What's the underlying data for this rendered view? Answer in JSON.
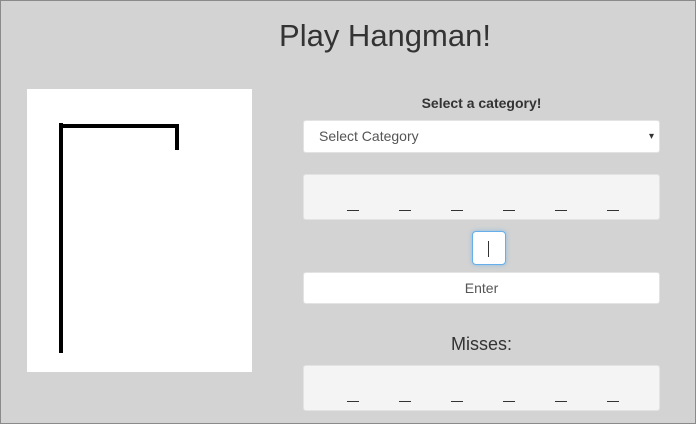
{
  "header": {
    "title": "Play Hangman!"
  },
  "category": {
    "label": "Select a category!",
    "selected": "Select Category",
    "caret": "▾"
  },
  "word": {
    "blanks": [
      "_",
      "_",
      "_",
      "_",
      "_",
      "_"
    ]
  },
  "guess": {
    "value": ""
  },
  "enter_button": {
    "label": "Enter"
  },
  "misses": {
    "label": "Misses:",
    "blanks": [
      "_",
      "_",
      "_",
      "_",
      "_",
      "_"
    ]
  },
  "gallows": {
    "stage": 0,
    "stroke_color": "#000000"
  }
}
